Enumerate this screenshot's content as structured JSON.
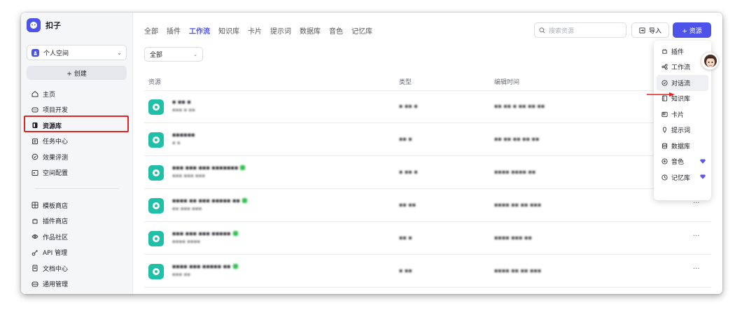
{
  "app": {
    "name": "扣子"
  },
  "sidebar": {
    "space": "个人空间",
    "create_label": "+ 创建",
    "nav_top": [
      {
        "label": "主页",
        "icon": "home-icon"
      },
      {
        "label": "项目开发",
        "icon": "project-icon"
      },
      {
        "label": "资源库",
        "icon": "library-icon"
      },
      {
        "label": "任务中心",
        "icon": "task-icon"
      },
      {
        "label": "效果评测",
        "icon": "evaluate-icon"
      },
      {
        "label": "空间配置",
        "icon": "space-config-icon"
      }
    ],
    "nav_bottom": [
      {
        "label": "模板商店",
        "icon": "template-store-icon"
      },
      {
        "label": "插件商店",
        "icon": "plugin-store-icon"
      },
      {
        "label": "作品社区",
        "icon": "community-icon"
      },
      {
        "label": "API 管理",
        "icon": "api-icon"
      },
      {
        "label": "文档中心",
        "icon": "docs-icon"
      },
      {
        "label": "通用管理",
        "icon": "general-manage-icon"
      }
    ],
    "active": "资源库"
  },
  "header": {
    "tabs": [
      "全部",
      "插件",
      "工作流",
      "知识库",
      "卡片",
      "提示词",
      "数据库",
      "音色",
      "记忆库"
    ],
    "active_tab": "工作流",
    "search_placeholder": "搜索资源",
    "import_label": "导入",
    "resource_label": "+ 资源"
  },
  "filter": {
    "value": "全部"
  },
  "table": {
    "columns": [
      "资源",
      "类型",
      "编辑时间"
    ],
    "rows": [
      {
        "name": "▪ ▪▪ ▪",
        "desc": "▪▪▪ ▪ ▪▪",
        "type": "▪ ▪▪ ▪",
        "time": "▪▪ ▪▪ ▪ ▪▪ ▪▪ ▪▪",
        "badge": false
      },
      {
        "name": "▪▪▪▪▪▪",
        "desc": "▪ ▪",
        "type": "▪▪ ▪",
        "time": "▪▪ ▪▪ ▪▪ ▪▪ ▪▪",
        "badge": false
      },
      {
        "name": "▪▪▪ ▪▪▪ ▪▪▪ ▪▪▪▪▪▪▪",
        "desc": "▪▪▪ ▪▪▪ ▪▪▪",
        "type": "▪ ▪▪ ▪",
        "time": "▪▪▪▪ ▪▪▪▪ ▪▪",
        "badge": true
      },
      {
        "name": "▪▪▪▪ ▪▪ ▪▪▪ ▪▪▪▪▪ ▪▪",
        "desc": "▪▪ ▪▪▪ ▪▪▪",
        "type": "▪▪ ▪▪",
        "time": "▪▪▪▪ ▪▪ ▪▪ ▪▪▪",
        "badge": true
      },
      {
        "name": "▪▪▪ ▪▪▪ ▪▪▪ ▪▪▪▪▪",
        "desc": "▪▪▪▪ ▪▪▪▪",
        "type": "▪▪ ▪",
        "time": "▪▪▪▪ ▪▪▪ ▪▪",
        "badge": true
      },
      {
        "name": "▪▪▪▪ ▪▪▪ ▪▪▪▪▪ ▪▪",
        "desc": "▪▪▪ ▪▪",
        "type": "▪ ▪▪",
        "time": "▪▪▪▪ ▪▪ ▪▪ ▪▪▪",
        "badge": true
      }
    ],
    "more_label": "···"
  },
  "dropdown": {
    "items": [
      {
        "label": "插件",
        "icon": "plugin-icon",
        "premium": false
      },
      {
        "label": "工作流",
        "icon": "workflow-icon",
        "premium": false
      },
      {
        "label": "对话流",
        "icon": "chatflow-icon",
        "premium": false
      },
      {
        "label": "知识库",
        "icon": "knowledge-icon",
        "premium": false
      },
      {
        "label": "卡片",
        "icon": "card-icon",
        "premium": false
      },
      {
        "label": "提示词",
        "icon": "prompt-icon",
        "premium": false
      },
      {
        "label": "数据库",
        "icon": "database-icon",
        "premium": false
      },
      {
        "label": "音色",
        "icon": "voice-icon",
        "premium": true
      },
      {
        "label": "记忆库",
        "icon": "memory-icon",
        "premium": true
      }
    ],
    "highlighted": "对话流"
  },
  "colors": {
    "brand": "#4d53e8",
    "resource_icon": "#1fc0a7",
    "highlight_box": "#e02424",
    "premium": "#5b57f0",
    "badge": "#2fbf4e"
  }
}
